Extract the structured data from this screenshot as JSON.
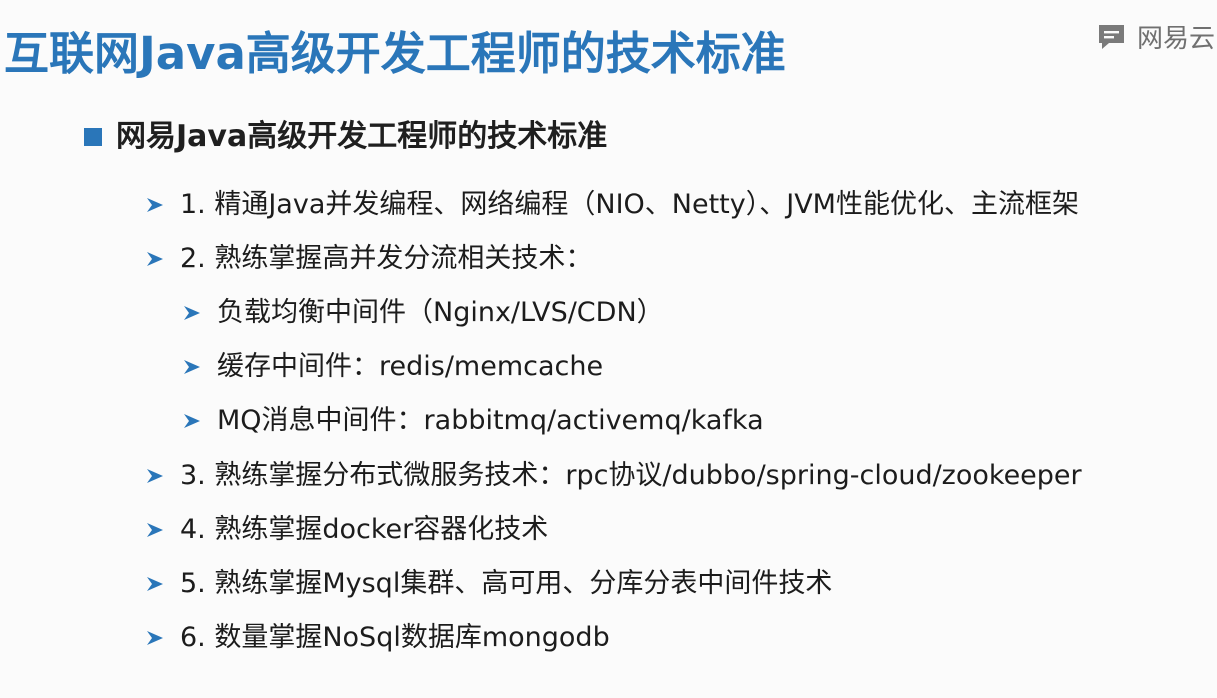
{
  "slide": {
    "title": "互联网Java高级开发工程师的技术标准",
    "logo_text": "网易云",
    "section_heading": "网易Java高级开发工程师的技术标准",
    "items": [
      {
        "text": "1. 精通Java并发编程、网络编程（NIO、Netty）、JVM性能优化、主流框架",
        "level": 1
      },
      {
        "text": "2. 熟练掌握高并发分流相关技术：",
        "level": 1
      },
      {
        "text": "负载均衡中间件（Nginx/LVS/CDN）",
        "level": 2
      },
      {
        "text": "缓存中间件：redis/memcache",
        "level": 2
      },
      {
        "text": "MQ消息中间件：rabbitmq/activemq/kafka",
        "level": 2
      },
      {
        "text": "3. 熟练掌握分布式微服务技术：rpc协议/dubbo/spring-cloud/zookeeper",
        "level": 1
      },
      {
        "text": "4. 熟练掌握docker容器化技术",
        "level": 1
      },
      {
        "text": "5. 熟练掌握Mysql集群、高可用、分库分表中间件技术",
        "level": 1
      },
      {
        "text": "6. 数量掌握NoSql数据库mongodb",
        "level": 1
      }
    ]
  },
  "colors": {
    "accent": "#2a76b9",
    "text": "#1c1c1c",
    "logo": "#707070"
  },
  "icons": {
    "logo": "chat-bubble-icon",
    "section_bullet": "square-bullet-icon",
    "item_bullet": "arrow-bullet-icon"
  }
}
